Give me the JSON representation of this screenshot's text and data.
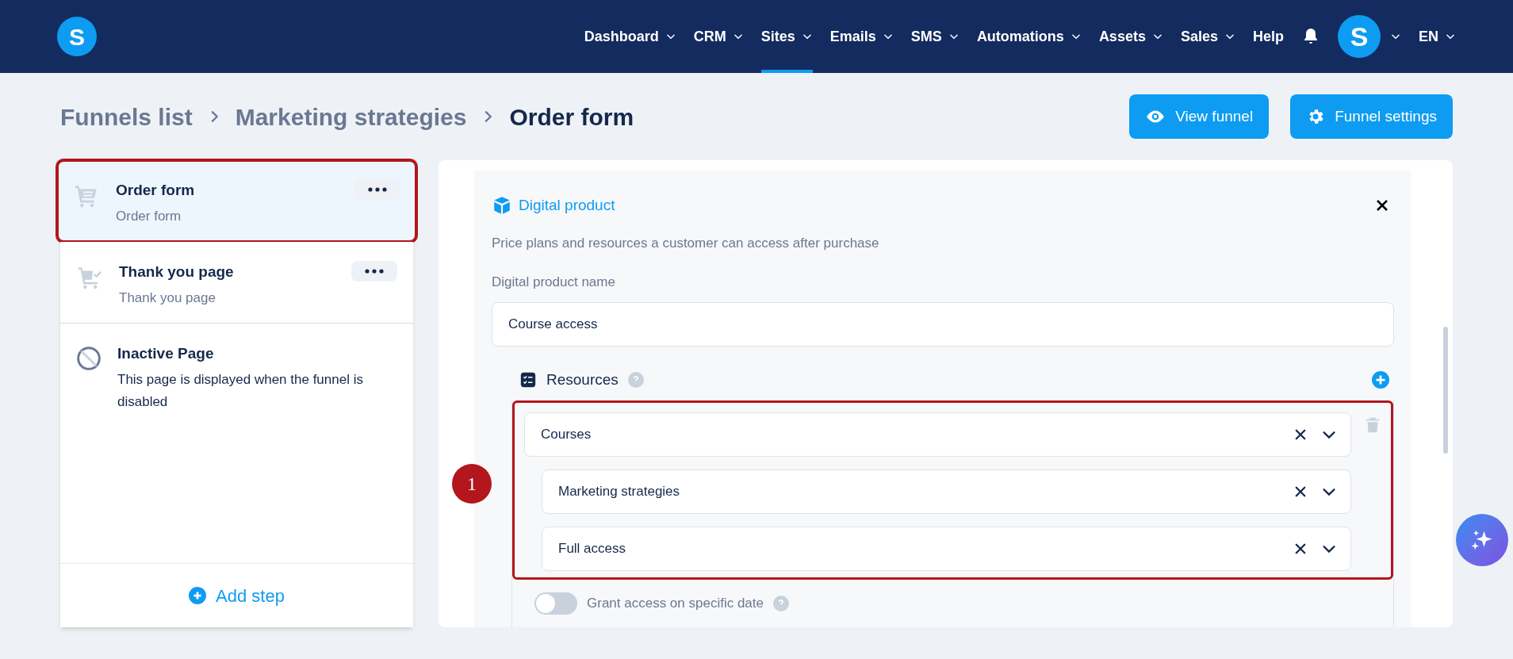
{
  "nav": {
    "logo": "S",
    "items": [
      {
        "label": "Dashboard",
        "dropdown": true,
        "selected": false
      },
      {
        "label": "CRM",
        "dropdown": true,
        "selected": false
      },
      {
        "label": "Sites",
        "dropdown": true,
        "selected": true
      },
      {
        "label": "Emails",
        "dropdown": true,
        "selected": false
      },
      {
        "label": "SMS",
        "dropdown": true,
        "selected": false
      },
      {
        "label": "Automations",
        "dropdown": true,
        "selected": false
      },
      {
        "label": "Assets",
        "dropdown": true,
        "selected": false
      },
      {
        "label": "Sales",
        "dropdown": true,
        "selected": false
      },
      {
        "label": "Help",
        "dropdown": false,
        "selected": false
      }
    ],
    "avatar": "S",
    "language": "EN"
  },
  "breadcrumb": [
    "Funnels list",
    "Marketing strategies",
    "Order form"
  ],
  "actions": [
    {
      "label": "View funnel",
      "kind": "view"
    },
    {
      "label": "Funnel settings",
      "kind": "settings"
    }
  ],
  "steps": [
    {
      "kind": "order",
      "title": "Order form",
      "subtitle": "Order form",
      "selected": true,
      "highlighted": true
    },
    {
      "kind": "thankyou",
      "title": "Thank you page",
      "subtitle": "Thank you page",
      "selected": false,
      "highlighted": false
    },
    {
      "kind": "inactive",
      "title": "Inactive Page",
      "subtitle": "This page is displayed when the funnel is disabled",
      "selected": false,
      "highlighted": false
    }
  ],
  "add_step": "Add step",
  "product": {
    "title": "Digital product",
    "description": "Price plans and resources a customer can access after purchase",
    "name_label": "Digital product name",
    "name_value": "Course access",
    "resources_label": "Resources",
    "resources_highlighted": true,
    "annotation": "1",
    "resources": [
      {
        "value": "Courses",
        "children": [
          {
            "value": "Marketing strategies"
          },
          {
            "value": "Full access"
          }
        ]
      }
    ],
    "toggle": {
      "label": "Grant access on specific date",
      "on": false
    }
  }
}
